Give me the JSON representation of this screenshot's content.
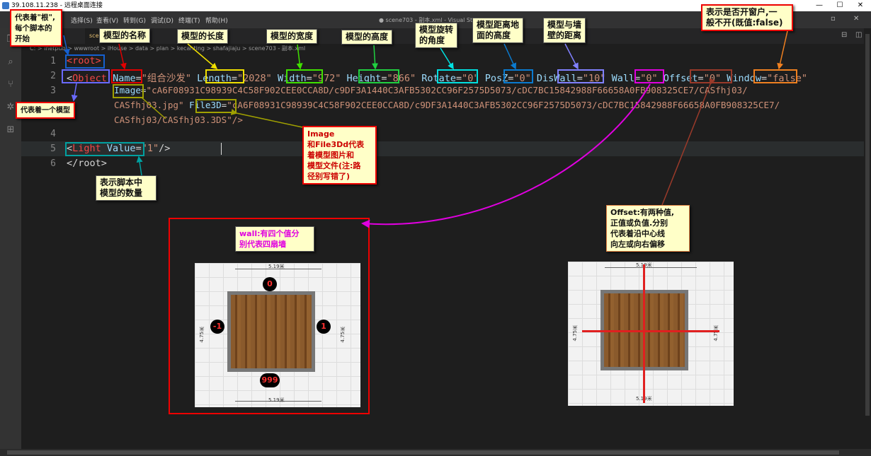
{
  "remote": {
    "title": "39.108.11.238 - 远程桌面连接",
    "btns": [
      "—",
      "☐",
      "✕"
    ]
  },
  "vscode": {
    "menu": [
      "选择(S)",
      "查看(V)",
      "转到(G)",
      "调试(D)",
      "终端(T)",
      "帮助(H)"
    ],
    "window_title": "● scene703 - 副本.xml - Visual Studio Code",
    "tabs": [
      "scene703 - 副本.xml"
    ],
    "breadcrumb": "C: > inetpub > wwwroot > iHouse > data > plan > kecanting > shafajiaju > scene703 - 副本.xml",
    "line_numbers": [
      "1",
      "2",
      "3",
      "4",
      "5",
      "6"
    ]
  },
  "code": {
    "l1_tag": "<root>",
    "l2_open": "<",
    "l2_tag": "Object",
    "name_a": "Name",
    "name_v": "\"组合沙发\"",
    "length_a": "Length",
    "length_v": "\"2028\"",
    "width_a": "Width",
    "width_v": "\"972\"",
    "height_a": "Height",
    "height_v": "\"866\"",
    "rotate_a": "Rotate",
    "rotate_v": "\"0\"",
    "posz_a": "PosZ",
    "posz_v": "\"0\"",
    "diswall_a": "DisWall",
    "diswall_v": "\"10\"",
    "wall_a": "Wall",
    "wall_v": "\"0\"",
    "offset_a": "Offset",
    "offset_v": "\"0\"",
    "window_a": "Window",
    "window_v": "\"false\"",
    "image_a": "Image",
    "image_v1": "\"cA6F08931C98939C4C58F902CEE0CCA8D/c9DF3A1440C3AFB5302CC96F2575D5073/cDC7BC15842988F66658A0FB908325CE7/CASfhj03/",
    "image_v2": "CASfhj03.jpg\"",
    "file3d_a": "File3D",
    "file3d_v1": "\"cA6F08931C98939C4C58F902CEE0CCA8D/c9DF3A1440C3AFB5302CC96F2575D5073/cDC7BC15842988F66658A0FB908325CE7/",
    "file3d_v2": "CASfhj03/CASfhj03.3DS\"/>",
    "l5_tag": "Light",
    "l5_a": "Value",
    "l5_v": "\"1\"",
    "l5_close": "/>",
    "l6": "</root>"
  },
  "notes": {
    "root": "代表着\"根\",\n每个脚本的\n开始",
    "model_name": "模型的名称",
    "model_length": "模型的长度",
    "model_width": "模型的宽度",
    "model_height": "模型的高度",
    "rotate": "模型旋转\n的角度",
    "posz": "模型距离地\n面的高度",
    "diswall": "模型与墙\n壁的距离",
    "window": "表示是否开窗户,一\n般不开(既值:false)",
    "object": "代表着一个模型",
    "image": "Image\n和File3Dd代表\n着模型图片和\n模型文件(注:路\n径别写错了)",
    "light": "表示脚本中\n模型的数量",
    "wall": "wall:有四个值分\n别代表四扇墙",
    "offset": "Offset:有两种值,\n正值或负值.分别\n代表着沿中心线\n向左或向右偏移"
  },
  "plan": {
    "dim_horizontal": "5.19米",
    "dim_vertical": "4.75米",
    "wall_badges": {
      "top": "0",
      "left": "-1",
      "right": "1",
      "bottom": "999"
    }
  },
  "colors": {
    "name": "#e00000",
    "length": "#f0e000",
    "width": "#40e000",
    "height": "#20d040",
    "rotate": "#00e0e0",
    "posz": "#0a7bd0",
    "diswall": "#8080ff",
    "wall": "#e000e0",
    "offset": "#9a3a2a",
    "window": "#f08020",
    "root": "#1560d0",
    "object": "#6a6aff",
    "image": "#a0a000",
    "light": "#00a0a0"
  }
}
